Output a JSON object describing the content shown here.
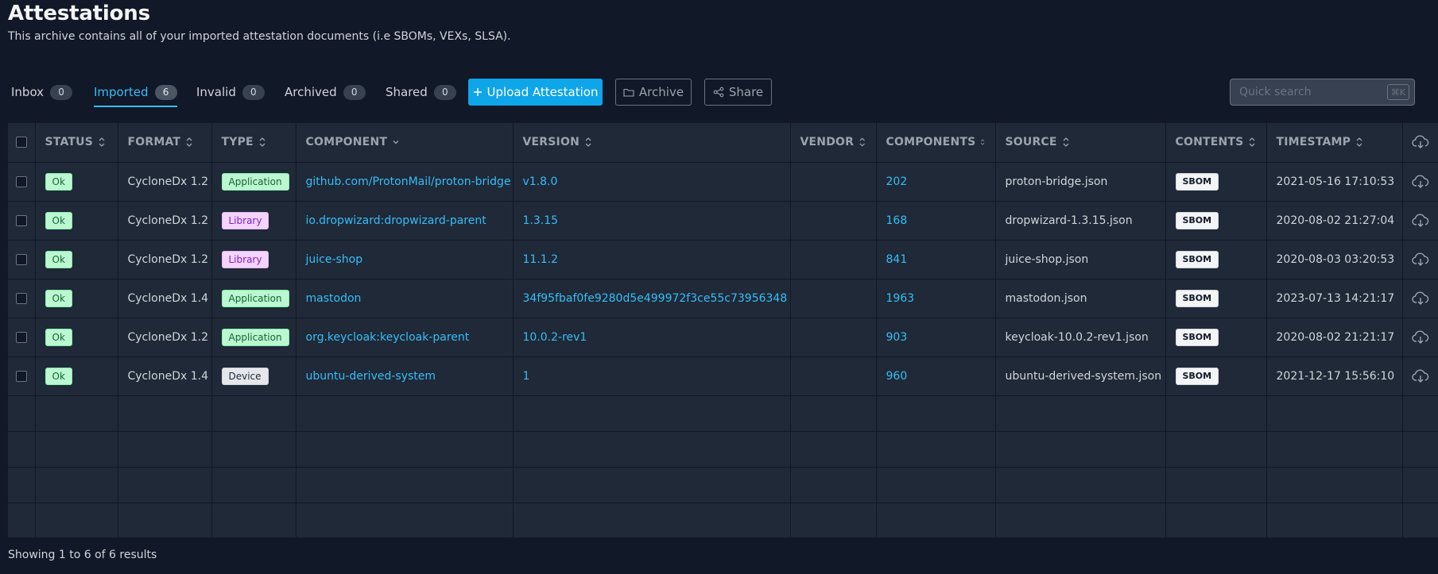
{
  "header": {
    "title": "Attestations",
    "subtitle": "This archive contains all of your imported attestation documents (i.e SBOMs, VEXs, SLSA)."
  },
  "tabs": [
    {
      "label": "Inbox",
      "count": "0"
    },
    {
      "label": "Imported",
      "count": "6"
    },
    {
      "label": "Invalid",
      "count": "0"
    },
    {
      "label": "Archived",
      "count": "0"
    },
    {
      "label": "Shared",
      "count": "0"
    }
  ],
  "actions": {
    "upload_label": "Upload Attestation",
    "archive_label": "Archive",
    "share_label": "Share"
  },
  "search": {
    "placeholder": "Quick search",
    "shortcut": "⌘K"
  },
  "table": {
    "columns": {
      "status": "STATUS",
      "format": "FORMAT",
      "type": "TYPE",
      "component": "COMPONENT",
      "version": "VERSION",
      "vendor": "VENDOR",
      "components": "COMPONENTS",
      "source": "SOURCE",
      "contents": "CONTENTS",
      "timestamp": "TIMESTAMP"
    },
    "rows": [
      {
        "status": "Ok",
        "format": "CycloneDx 1.2",
        "type": "Application",
        "component": "github.com/ProtonMail/proton-bridge",
        "version": "v1.8.0",
        "vendor": "",
        "components": "202",
        "source": "proton-bridge.json",
        "contents": "SBOM",
        "timestamp": "2021-05-16 17:10:53"
      },
      {
        "status": "Ok",
        "format": "CycloneDx 1.2",
        "type": "Library",
        "component": "io.dropwizard:dropwizard-parent",
        "version": "1.3.15",
        "vendor": "",
        "components": "168",
        "source": "dropwizard-1.3.15.json",
        "contents": "SBOM",
        "timestamp": "2020-08-02 21:27:04"
      },
      {
        "status": "Ok",
        "format": "CycloneDx 1.2",
        "type": "Library",
        "component": "juice-shop",
        "version": "11.1.2",
        "vendor": "",
        "components": "841",
        "source": "juice-shop.json",
        "contents": "SBOM",
        "timestamp": "2020-08-03 03:20:53"
      },
      {
        "status": "Ok",
        "format": "CycloneDx 1.4",
        "type": "Application",
        "component": "mastodon",
        "version": "34f95fbaf0fe9280d5e499972f3ce55c73956348",
        "vendor": "",
        "components": "1963",
        "source": "mastodon.json",
        "contents": "SBOM",
        "timestamp": "2023-07-13 14:21:17"
      },
      {
        "status": "Ok",
        "format": "CycloneDx 1.2",
        "type": "Application",
        "component": "org.keycloak:keycloak-parent",
        "version": "10.0.2-rev1",
        "vendor": "",
        "components": "903",
        "source": "keycloak-10.0.2-rev1.json",
        "contents": "SBOM",
        "timestamp": "2020-08-02 21:21:17"
      },
      {
        "status": "Ok",
        "format": "CycloneDx 1.4",
        "type": "Device",
        "component": "ubuntu-derived-system",
        "version": "1",
        "vendor": "",
        "components": "960",
        "source": "ubuntu-derived-system.json",
        "contents": "SBOM",
        "timestamp": "2021-12-17 15:56:10"
      }
    ]
  },
  "footer": {
    "results_text": "Showing 1 to 6 of 6 results"
  },
  "colors": {
    "background": "#111827",
    "table_bg": "#1f2937",
    "accent": "#0ea5e9",
    "link": "#38bdf8"
  }
}
